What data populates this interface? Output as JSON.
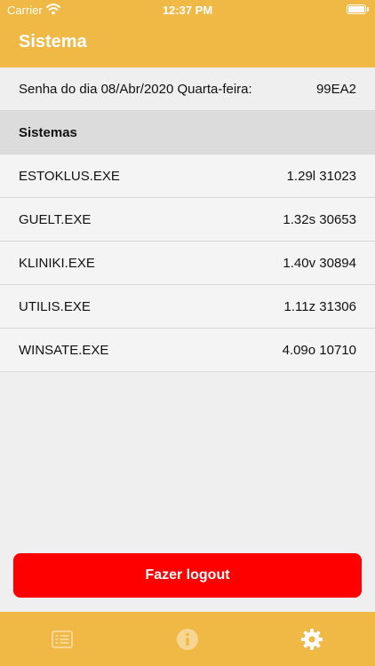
{
  "status_bar": {
    "carrier": "Carrier",
    "time": "12:37 PM",
    "icons": [
      "wifi-icon",
      "battery-icon"
    ]
  },
  "header": {
    "title": "Sistema"
  },
  "password": {
    "label": "Senha do dia 08/Abr/2020 Quarta-feira:",
    "value": "99EA2"
  },
  "section": {
    "title": "Sistemas"
  },
  "systems": [
    {
      "name": "ESTOKLUS.EXE",
      "version": "1.29l 31023"
    },
    {
      "name": "GUELT.EXE",
      "version": "1.32s 30653"
    },
    {
      "name": "KLINIKI.EXE",
      "version": "1.40v 30894"
    },
    {
      "name": "UTILIS.EXE",
      "version": "1.11z 31306"
    },
    {
      "name": "WINSATE.EXE",
      "version": "4.09o 10710"
    }
  ],
  "logout": {
    "label": "Fazer logout"
  },
  "tabbar": {
    "tabs": [
      "list-icon",
      "info-icon",
      "gear-icon"
    ],
    "selected": "gear-icon"
  },
  "colors": {
    "accent": "#f0b845",
    "logout": "#ff0000",
    "tab_inactive": "#f7d592",
    "tab_active": "#ffffff"
  }
}
